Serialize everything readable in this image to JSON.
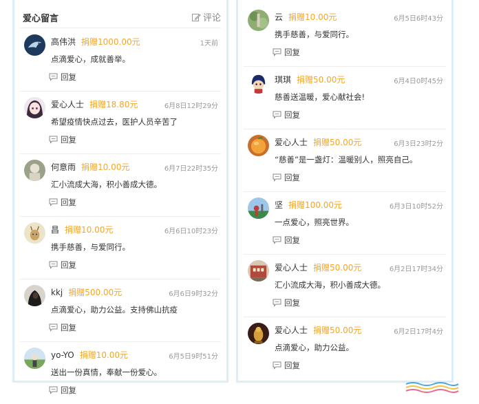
{
  "header": {
    "title": "爱心留言",
    "action_label": "评论"
  },
  "reply_label": "回复",
  "left_comments": [
    {
      "name": "高伟洪",
      "donation": "捐赠1000.00元",
      "time": "1天前",
      "message": "点滴爱心，成就善举。",
      "avatar": "dolphin-avatar"
    },
    {
      "name": "爱心人士",
      "donation": "捐赠18.80元",
      "time": "6月8日12时29分",
      "message": "希望疫情快点过去，医护人员辛苦了",
      "avatar": "anime-girl-avatar"
    },
    {
      "name": "何意雨",
      "donation": "捐赠10.00元",
      "time": "6月7日22时35分",
      "message": "汇小流成大海，积小善成大德。",
      "avatar": "person-photo-avatar"
    },
    {
      "name": "昌",
      "donation": "捐赠10.00元",
      "time": "6月6日10时23分",
      "message": "携手慈善，与爱同行。",
      "avatar": "cartoon-deer-avatar"
    },
    {
      "name": "kkj",
      "donation": "捐赠500.00元",
      "time": "6月6日9时32分",
      "message": "点滴爱心，助力公益。支持佛山抗疫",
      "avatar": "dark-figure-avatar"
    },
    {
      "name": "yo-YO",
      "donation": "捐赠10.00元",
      "time": "6月5日9时51分",
      "message": "送出一份真情，奉献一份爱心。",
      "avatar": "landscape-avatar"
    }
  ],
  "right_comments": [
    {
      "name": "云",
      "donation": "捐赠10.00元",
      "time": "6月5日6时43分",
      "message": "携手慈善，与爱同行。",
      "avatar": "greenery-avatar"
    },
    {
      "name": "琪琪",
      "donation": "捐赠50.00元",
      "time": "6月4日0时45分",
      "message": "慈善送温暖，爱心献社会!",
      "avatar": "cartoon-character-avatar"
    },
    {
      "name": "爱心人士",
      "donation": "捐赠50.00元",
      "time": "6月3日23时2分",
      "message": "“慈善”是一盏灯：温暖别人，照亮自己。",
      "avatar": "orange-fruit-avatar"
    },
    {
      "name": "坚",
      "donation": "捐赠100.00元",
      "time": "6月3日10时52分",
      "message": "一点爱心，照亮世界。",
      "avatar": "outdoor-photo-avatar"
    },
    {
      "name": "爱心人士",
      "donation": "捐赠50.00元",
      "time": "6月2日17时34分",
      "message": "汇小流成大海，积小善成大德。",
      "avatar": "building-photo-avatar"
    },
    {
      "name": "爱心人士",
      "donation": "捐赠50.00元",
      "time": "6月2日17时4分",
      "message": "点滴爱心，助力公益。",
      "avatar": "golden-statue-avatar"
    }
  ],
  "colors": {
    "donation": "#f5a623",
    "panel_border": "#dceef8",
    "divider": "#eeeeee"
  }
}
